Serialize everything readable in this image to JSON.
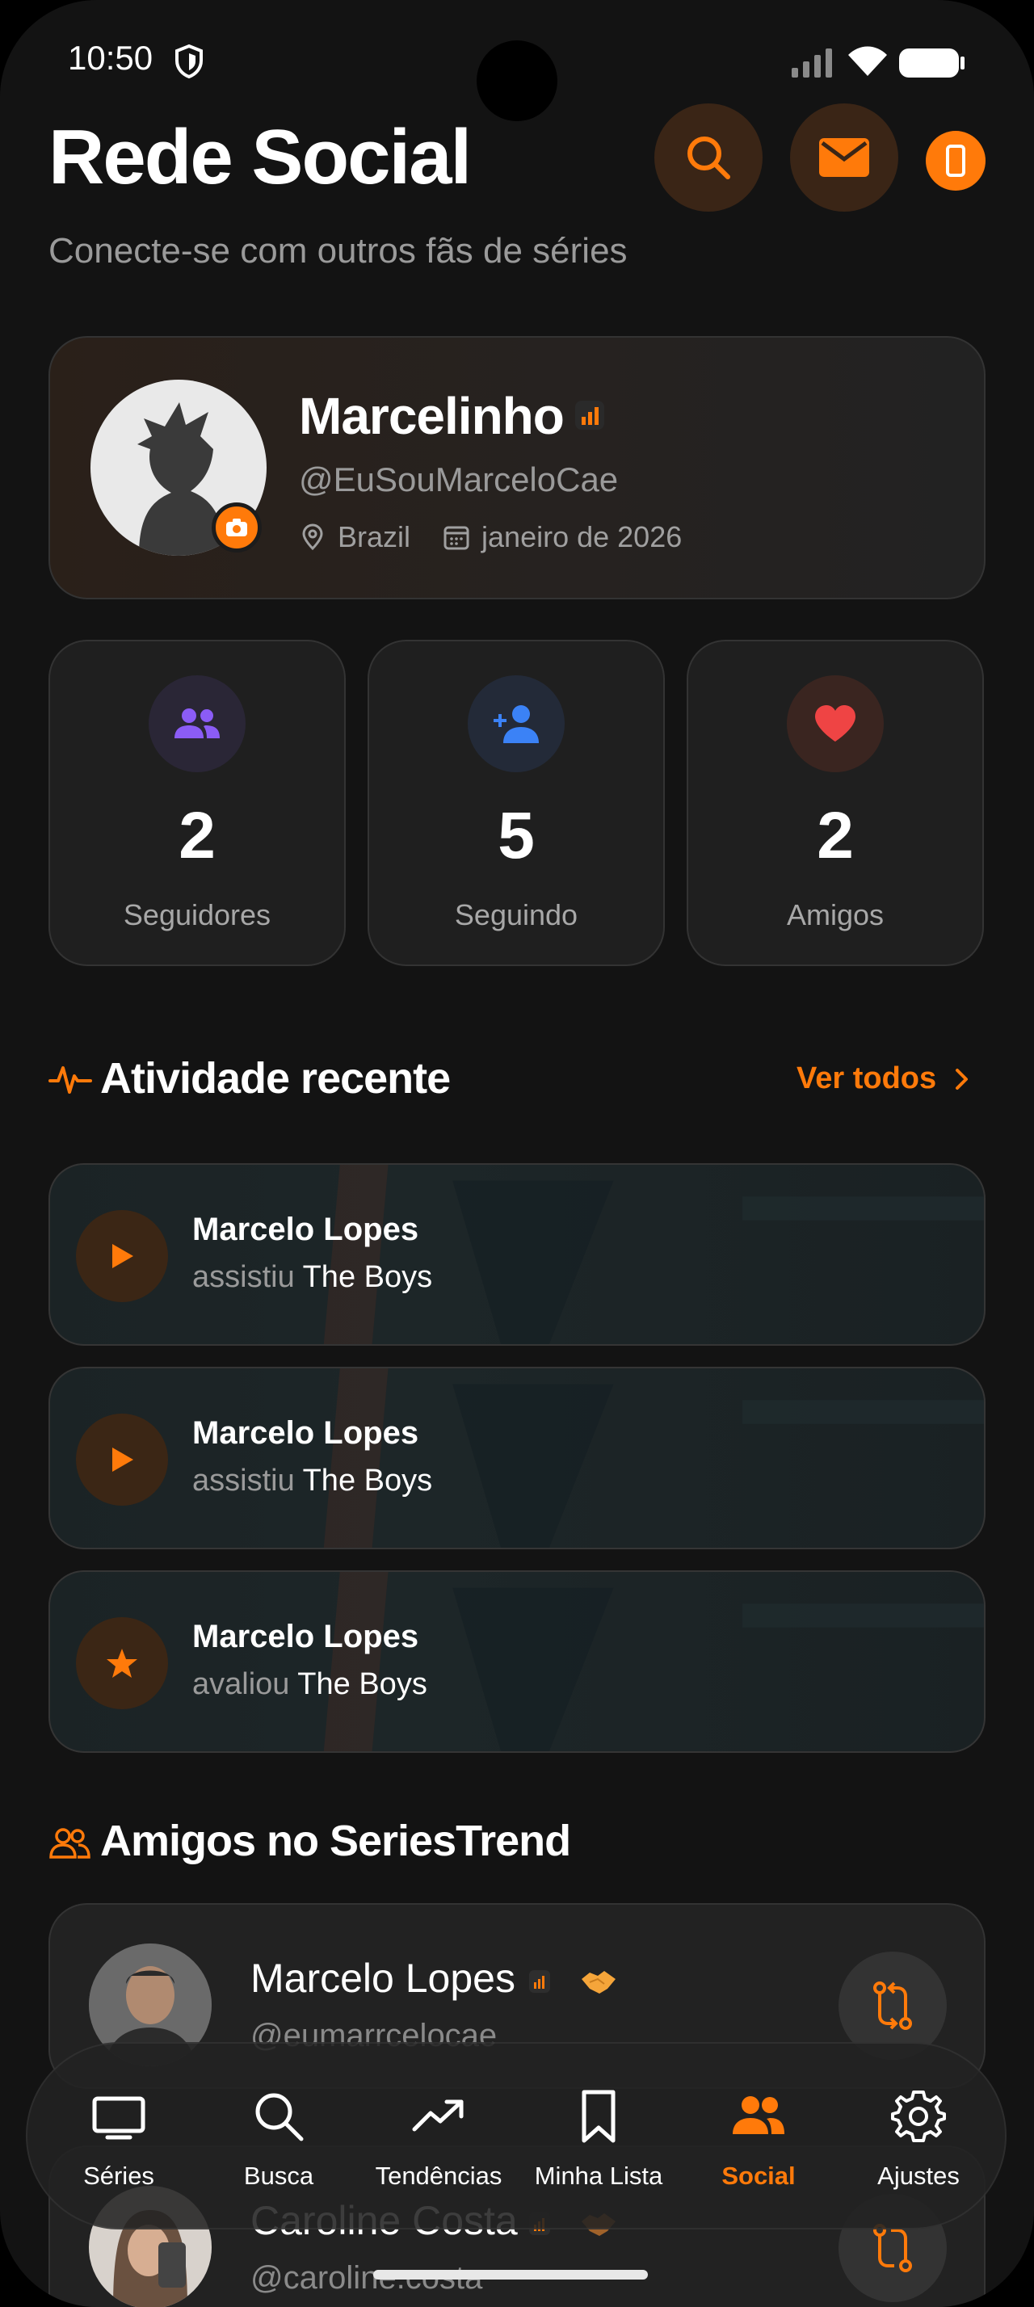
{
  "status_bar": {
    "time": "10:50"
  },
  "header": {
    "title": "Rede Social",
    "subtitle": "Conecte-se com outros fãs de séries",
    "icons": [
      "search-icon",
      "mail-icon",
      "phone-icon"
    ]
  },
  "profile": {
    "name": "Marcelinho",
    "handle": "@EuSouMarceloCae",
    "location": "Brazil",
    "joined": "janeiro de 2026"
  },
  "stats": [
    {
      "value": "2",
      "label": "Seguidores",
      "icon": "users-icon",
      "color": "#8b5cf6"
    },
    {
      "value": "5",
      "label": "Seguindo",
      "icon": "user-plus-icon",
      "color": "#3b82f6"
    },
    {
      "value": "2",
      "label": "Amigos",
      "icon": "heart-icon",
      "color": "#ef4444"
    }
  ],
  "activity": {
    "title": "Atividade recente",
    "see_all": "Ver todos",
    "items": [
      {
        "user": "Marcelo Lopes",
        "verb": "assistiu",
        "show": "The Boys",
        "icon": "play-icon"
      },
      {
        "user": "Marcelo Lopes",
        "verb": "assistiu",
        "show": "The Boys",
        "icon": "play-icon"
      },
      {
        "user": "Marcelo Lopes",
        "verb": "avaliou",
        "show": "The Boys",
        "icon": "star-icon"
      }
    ]
  },
  "friends": {
    "title": "Amigos no SeriesTrend",
    "items": [
      {
        "name": "Marcelo Lopes",
        "handle": "@eumarrcelocae"
      },
      {
        "name": "Caroline Costa",
        "handle": "@caroline.costa"
      }
    ]
  },
  "nav": {
    "items": [
      {
        "label": "Séries",
        "icon": "tv-icon"
      },
      {
        "label": "Busca",
        "icon": "search-icon"
      },
      {
        "label": "Tendências",
        "icon": "trending-icon"
      },
      {
        "label": "Minha Lista",
        "icon": "bookmark-icon"
      },
      {
        "label": "Social",
        "icon": "people-icon",
        "active": true
      },
      {
        "label": "Ajustes",
        "icon": "gear-icon"
      }
    ]
  },
  "colors": {
    "accent": "#ff7a0a",
    "background": "#131313"
  }
}
